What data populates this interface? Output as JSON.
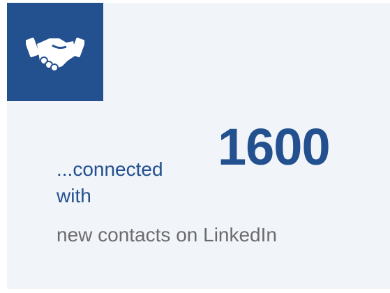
{
  "stat": {
    "icon": "handshake-icon",
    "accent_color": "#23508f",
    "lead_text": "...connected",
    "lead_text_2": "with",
    "number": "1600",
    "description": "new contacts on LinkedIn"
  }
}
